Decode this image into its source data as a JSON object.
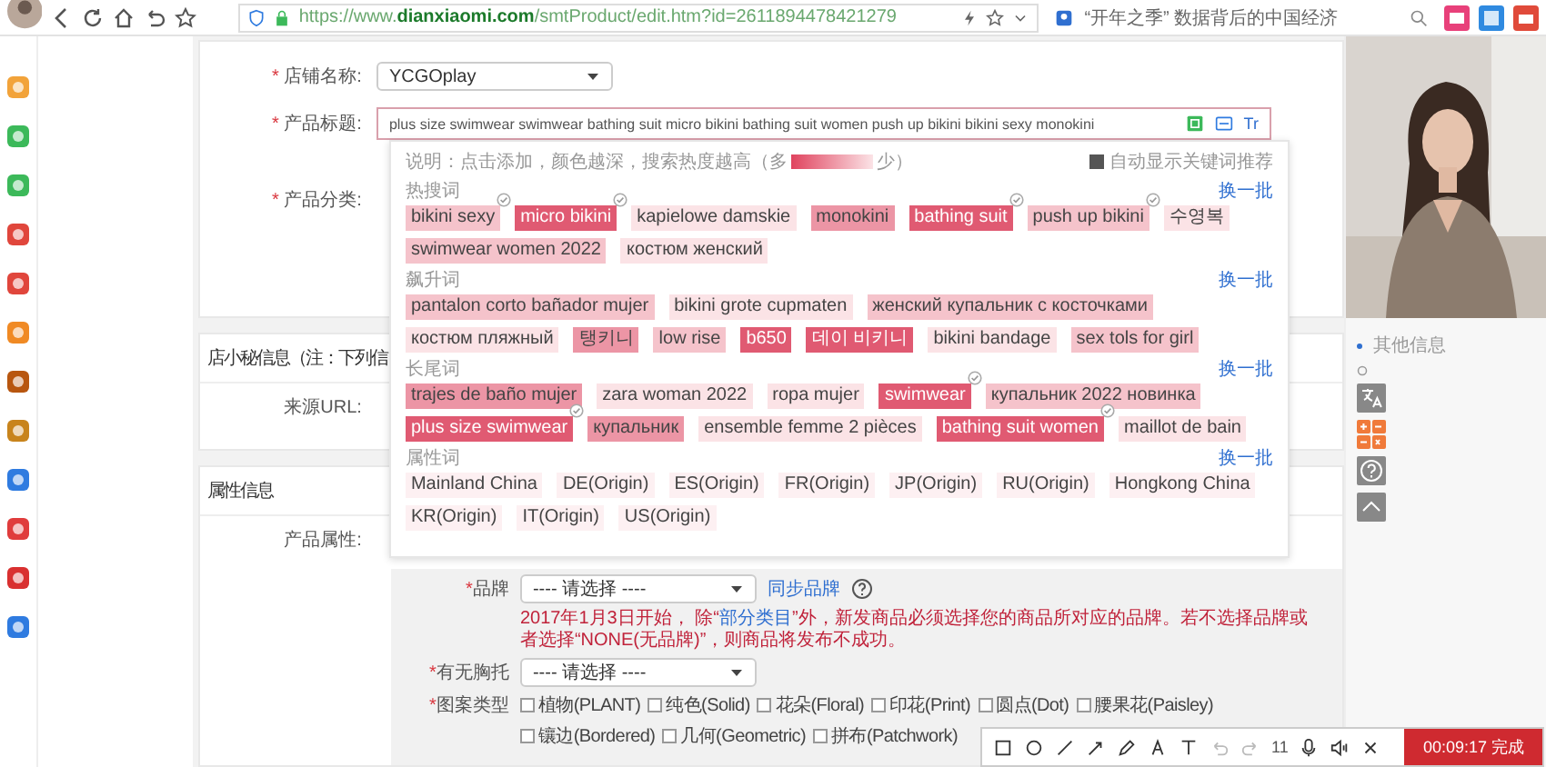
{
  "browser": {
    "url": {
      "scheme": "https://www.",
      "domain": "dianxiaomi.com",
      "path": "/smtProduct/edit.htm?id=2611894478421279"
    },
    "search": "“开年之季” 数据背后的中国经济"
  },
  "form": {
    "shop": {
      "label": "店铺名称:",
      "mark": "*",
      "value": "YCGOplay"
    },
    "title": {
      "label": "产品标题:",
      "mark": "*",
      "value": "plus size swimwear  swimwear  bathing suit  micro bikini  bathing suit women  push up bikini  bikini sexy  monokini",
      "tool": "Tr"
    },
    "category": {
      "label": "产品分类:",
      "mark": "*"
    },
    "info_header": "店小秘信息（注：下列信",
    "source_label": "来源URL:",
    "attr_header": "属性信息",
    "attr_label": "产品属性:",
    "brand": {
      "label": "品牌",
      "mark": "*",
      "value": "---- 请选择 ----",
      "sync": "同步品牌",
      "notice_before": "2017年1月3日开始， 除“",
      "notice_link": "部分类目",
      "notice_after": "”外，新发商品必须选择您的商品所对应的品牌。若不选择品牌或者选择“NONE(无品牌)”，则商品将发布不成功。"
    },
    "padding": {
      "label": "有无胸托",
      "mark": "*",
      "value": "---- 请选择 ----"
    },
    "pattern": {
      "label": "图案类型",
      "mark": "*",
      "options": [
        {
          "label": "植物(PLANT)",
          "checked": false
        },
        {
          "label": "纯色(Solid)",
          "checked": false
        },
        {
          "label": "花朵(Floral)",
          "checked": false
        },
        {
          "label": "印花(Print)",
          "checked": false
        },
        {
          "label": "圆点(Dot)",
          "checked": false
        },
        {
          "label": "腰果花(Paisley)",
          "checked": false
        },
        {
          "label": "镶边(Bordered)",
          "checked": false
        },
        {
          "label": "几何(Geometric)",
          "checked": false
        },
        {
          "label": "拼布(Patchwork)",
          "checked": false
        }
      ]
    }
  },
  "keywords": {
    "hint_before": "说明：点击添加，颜色越深，搜索热度越高（多",
    "hint_after": "少）",
    "auto": {
      "label": "自动显示关键词推荐",
      "checked": true
    },
    "groups": [
      {
        "title": "热搜词",
        "refresh": "换一批",
        "tags": [
          {
            "text": "bikini sexy",
            "color": "#f5c3cb",
            "checked": true
          },
          {
            "text": "micro bikini",
            "color": "#e05a72",
            "checked": true
          },
          {
            "text": "kapielowe damskie",
            "color": "#fbe3e6",
            "checked": false
          },
          {
            "text": "monokini",
            "color": "#ec95a5",
            "checked": false
          },
          {
            "text": "bathing suit",
            "color": "#e05a72",
            "checked": true
          },
          {
            "text": "push up bikini",
            "color": "#f5c3cb",
            "checked": true
          },
          {
            "text": "수영복",
            "color": "#fbe3e6",
            "checked": false
          },
          {
            "text": "swimwear women 2022",
            "color": "#f5c3cb",
            "checked": false
          },
          {
            "text": "костюм женский",
            "color": "#fbe3e6",
            "checked": false
          }
        ]
      },
      {
        "title": "飙升词",
        "refresh": "换一批",
        "tags": [
          {
            "text": "pantalon corto bañador mujer",
            "color": "#f5c3cb",
            "checked": false
          },
          {
            "text": "bikini grote cupmaten",
            "color": "#fbe3e6",
            "checked": false
          },
          {
            "text": "женский купальник с косточками",
            "color": "#f5c3cb",
            "checked": false
          },
          {
            "text": "костюм пляжный",
            "color": "#fbe3e6",
            "checked": false
          },
          {
            "text": "탱키니",
            "color": "#ec95a5",
            "checked": false
          },
          {
            "text": "low rise",
            "color": "#f5c3cb",
            "checked": false
          },
          {
            "text": "b650",
            "color": "#e05a72",
            "checked": false
          },
          {
            "text": "데이 비키니",
            "color": "#e05a72",
            "checked": false
          },
          {
            "text": "bikini bandage",
            "color": "#fbe3e6",
            "checked": false
          },
          {
            "text": "sex tols for girl",
            "color": "#f5c3cb",
            "checked": false
          }
        ]
      },
      {
        "title": "长尾词",
        "refresh": "换一批",
        "tags": [
          {
            "text": "trajes de baño mujer",
            "color": "#ec95a5",
            "checked": false
          },
          {
            "text": "zara woman 2022",
            "color": "#fbe3e6",
            "checked": false
          },
          {
            "text": "ropa mujer",
            "color": "#fbe3e6",
            "checked": false
          },
          {
            "text": "swimwear",
            "color": "#e05a72",
            "checked": true
          },
          {
            "text": "купальник 2022 новинка",
            "color": "#f5c3cb",
            "checked": false
          },
          {
            "text": "plus size swimwear",
            "color": "#e05a72",
            "checked": true
          },
          {
            "text": "купальник",
            "color": "#ec95a5",
            "checked": false
          },
          {
            "text": "ensemble femme 2 pièces",
            "color": "#fbe3e6",
            "checked": false
          },
          {
            "text": "bathing suit women",
            "color": "#e05a72",
            "checked": true
          },
          {
            "text": "maillot de bain",
            "color": "#fbe3e6",
            "checked": false
          }
        ]
      },
      {
        "title": "属性词",
        "refresh": "换一批",
        "tags": [
          {
            "text": "Mainland China",
            "color": "#fdf0f2",
            "checked": false
          },
          {
            "text": "DE(Origin)",
            "color": "#fdf0f2",
            "checked": false
          },
          {
            "text": "ES(Origin)",
            "color": "#fdf0f2",
            "checked": false
          },
          {
            "text": "FR(Origin)",
            "color": "#fdf0f2",
            "checked": false
          },
          {
            "text": "JP(Origin)",
            "color": "#fdf0f2",
            "checked": false
          },
          {
            "text": "RU(Origin)",
            "color": "#fdf0f2",
            "checked": false
          },
          {
            "text": "Hongkong China",
            "color": "#fdf0f2",
            "checked": false
          },
          {
            "text": "KR(Origin)",
            "color": "#fdf0f2",
            "checked": false
          },
          {
            "text": "IT(Origin)",
            "color": "#fdf0f2",
            "checked": false
          },
          {
            "text": "US(Origin)",
            "color": "#fdf0f2",
            "checked": false
          }
        ]
      }
    ]
  },
  "side_nav": {
    "label": "其他信息"
  },
  "recorder": {
    "count": "11",
    "timer": "00:09:17 完成"
  }
}
